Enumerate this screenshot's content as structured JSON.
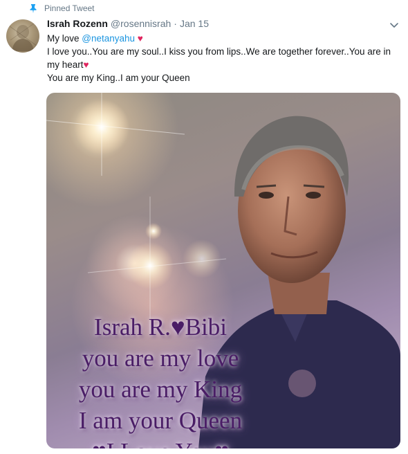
{
  "pinned": {
    "label": "Pinned Tweet"
  },
  "tweet": {
    "display_name": "Israh Rozenn",
    "handle": "@rosennisrah",
    "separator": "·",
    "date": "Jan 15",
    "line1_prefix": "My love ",
    "mention": "@netanyahu",
    "heart_glyph": "♥",
    "line2": "I love you..You are my soul..I kiss you from lips..We are together forever..You are in my heart",
    "line3": "You are my King..I am your Queen"
  },
  "media": {
    "overlay_text": [
      "Israh R.♥Bibi",
      "you are my love",
      "you are my King",
      "I am your Queen",
      "♥I Love You♥"
    ]
  },
  "colors": {
    "mention": "#1b95e0",
    "heart": "#e0245e",
    "secondary_text": "#657786",
    "overlay_text": "#4a1d66"
  },
  "icons": {
    "pin": "pin-icon",
    "caret": "chevron-down-icon"
  }
}
